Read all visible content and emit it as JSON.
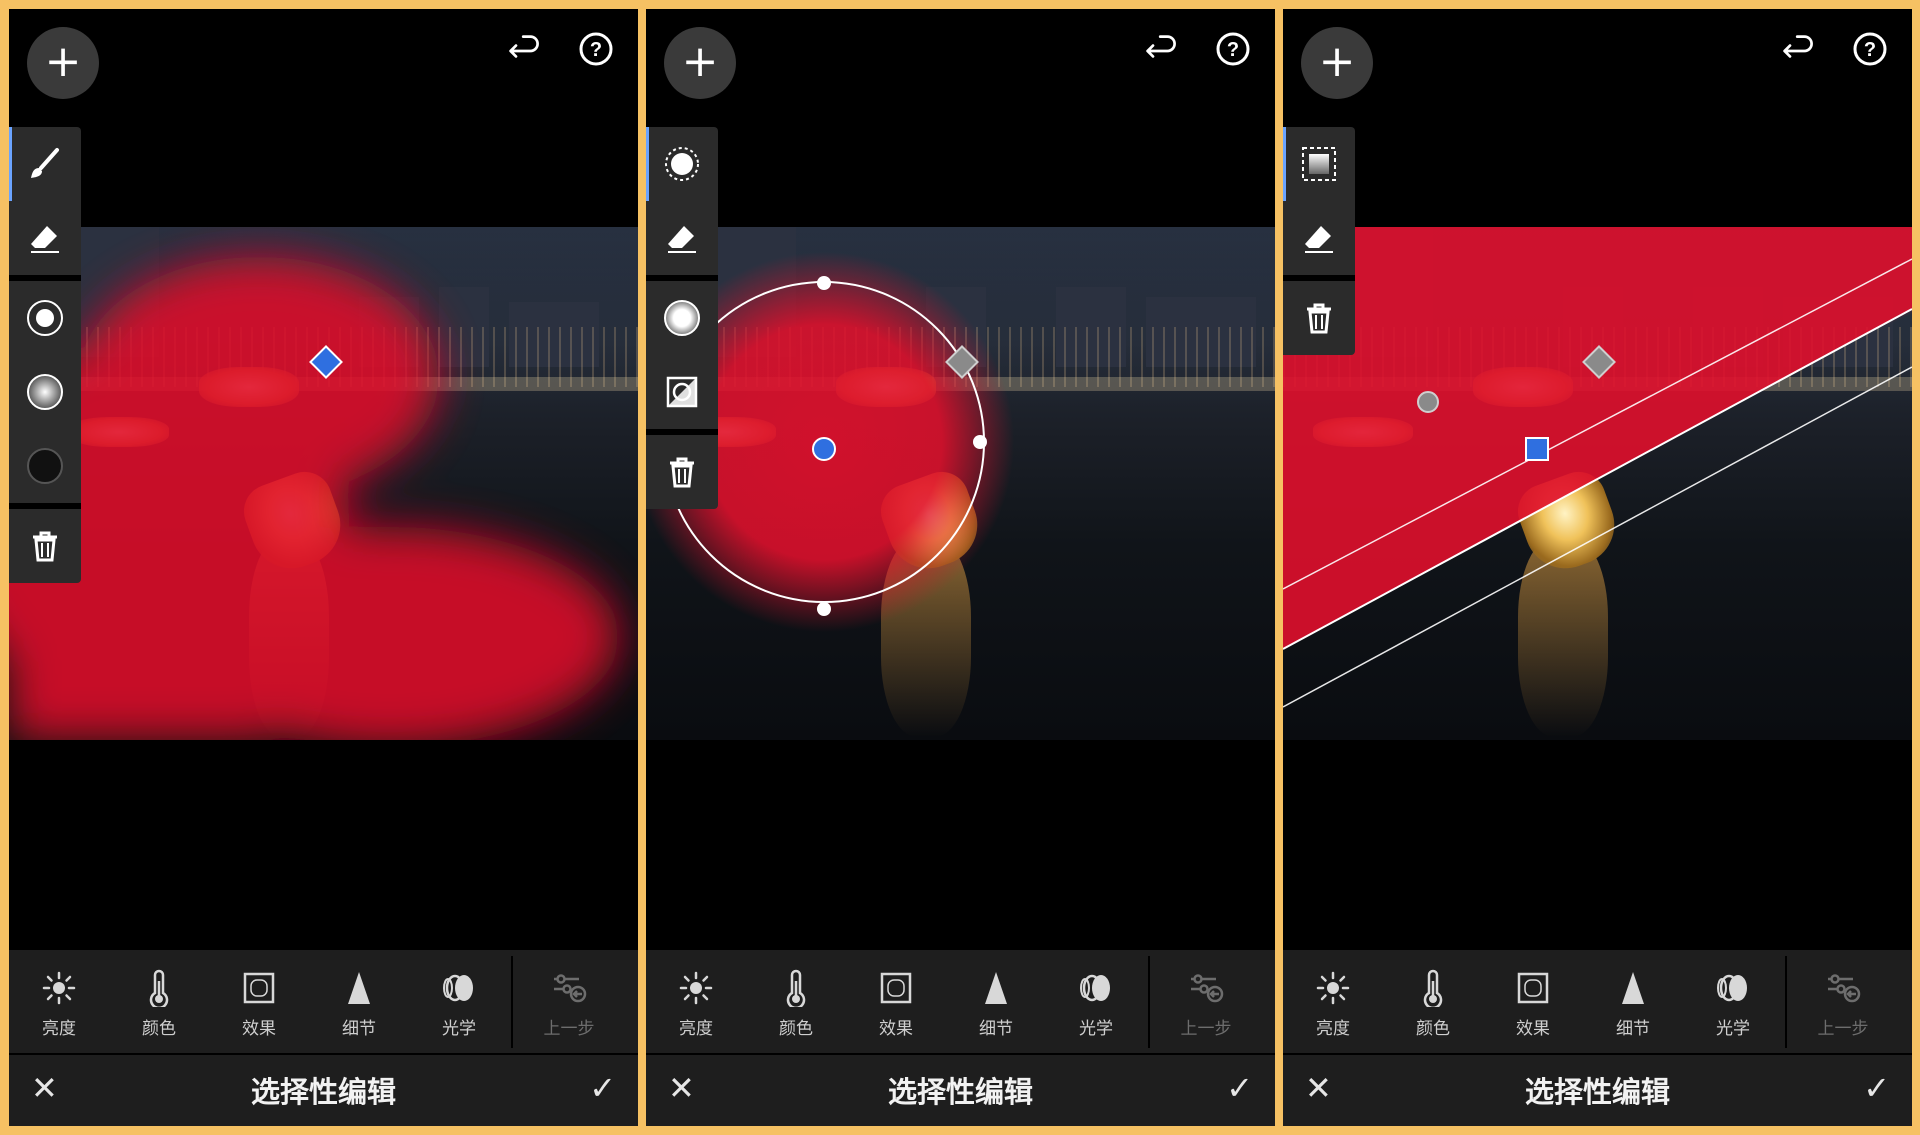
{
  "panels": [
    {
      "id": "brush",
      "top_icons": [
        "plus-icon",
        "undo-icon",
        "help-icon"
      ],
      "tools": [
        "brush-icon",
        "eraser-icon",
        "brush-size-icon",
        "brush-soft-icon",
        "brush-flow-icon",
        "trash-icon"
      ],
      "mask": "brush"
    },
    {
      "id": "radial",
      "top_icons": [
        "plus-icon",
        "undo-icon",
        "help-icon"
      ],
      "tools": [
        "radial-mask-icon",
        "eraser-icon",
        "feather-icon",
        "invert-icon",
        "trash-icon"
      ],
      "mask": "radial"
    },
    {
      "id": "linear",
      "top_icons": [
        "plus-icon",
        "undo-icon",
        "help-icon"
      ],
      "tools": [
        "linear-mask-icon",
        "eraser-icon",
        "trash-icon"
      ],
      "mask": "linear"
    }
  ],
  "top": {
    "add_label": "+"
  },
  "bottom_tabs": [
    {
      "label": "亮度",
      "icon": "sun-icon"
    },
    {
      "label": "颜色",
      "icon": "thermometer-icon"
    },
    {
      "label": "效果",
      "icon": "vignette-icon"
    },
    {
      "label": "细节",
      "icon": "triangle-icon"
    },
    {
      "label": "光学",
      "icon": "lens-icon"
    },
    {
      "label": "上一步",
      "icon": "previous-settings-icon"
    }
  ],
  "footer": {
    "title": "选择性编辑",
    "cancel": "✕",
    "confirm": "✓"
  },
  "colors": {
    "mask": "#e0102c",
    "pin": "#2f6fe0",
    "border": "#f6c163"
  }
}
